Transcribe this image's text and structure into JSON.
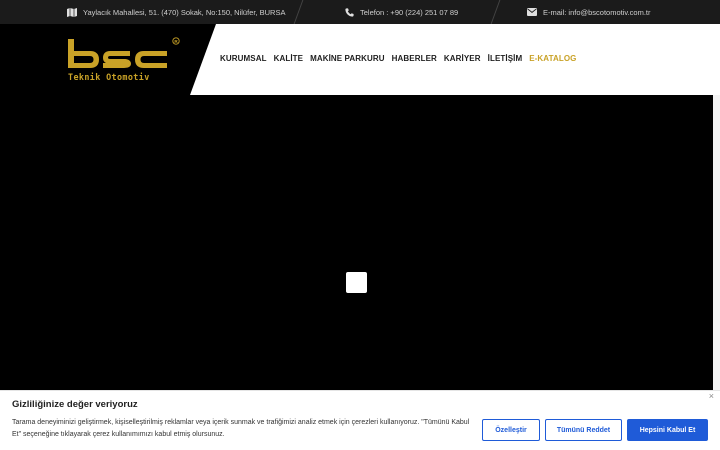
{
  "topbar": {
    "address_icon": "map-icon",
    "address": "Yaylacık Mahallesi, 51. (470) Sokak, No:150, Nilüfer, BURSA",
    "phone_icon": "phone-icon",
    "phone": "Telefon :  +90 (224) 251 07 89",
    "email_icon": "envelope-icon",
    "email": "E-mail: info@bscotomotiv.com.tr"
  },
  "brand": {
    "logo_text": "bsc",
    "logo_sub": "Teknik Otomotiv",
    "registered_mark": "®",
    "gold": "#c9a227"
  },
  "nav": {
    "items": [
      {
        "label": "KURUMSAL"
      },
      {
        "label": "KALİTE"
      },
      {
        "label": "MAKİNE PARKURU"
      },
      {
        "label": "HABERLER"
      },
      {
        "label": "KARİYER"
      },
      {
        "label": "İLETİŞİM"
      },
      {
        "label": "E-KATALOG"
      }
    ]
  },
  "video": {
    "play_icon": "play-icon"
  },
  "cookie": {
    "title": "Gizliliğinize değer veriyoruz",
    "line1": "Tarama deneyiminizi geliştirmek, kişiselleştirilmiş reklamlar veya içerik sunmak ve trafiğimizi analiz etmek için çerezleri kullanıyoruz. \"Tümünü Kabul",
    "line2": "Et\" seçeneğine tıklayarak çerez kullanımımızı kabul etmiş olursunuz.",
    "customize": "Özelleştir",
    "reject_all": "Tümünü Reddet",
    "accept_all": "Hepsini Kabul Et",
    "close": "×",
    "accent": "#1f5bd8"
  }
}
